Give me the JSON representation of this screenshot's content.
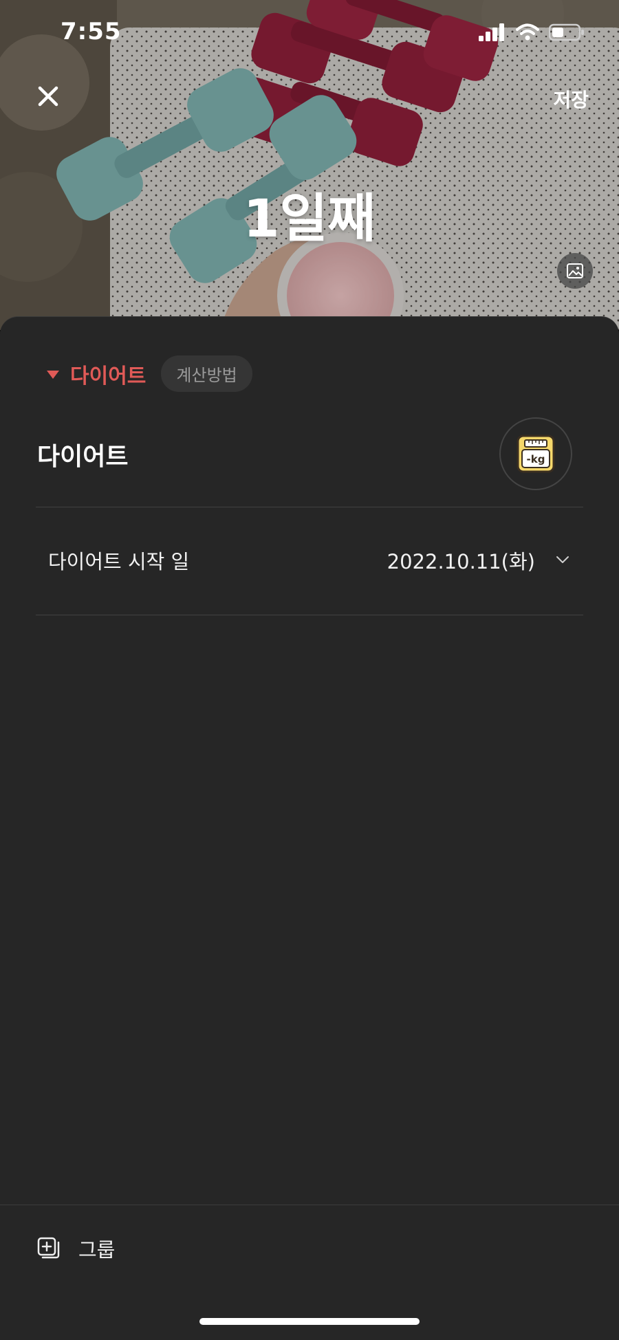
{
  "status_bar": {
    "time": "7:55",
    "signal_icon": "cellular-signal-icon",
    "wifi_icon": "wifi-icon",
    "battery_icon": "battery-icon"
  },
  "header": {
    "close_icon": "close-icon",
    "save_label": "저장",
    "title": "1일째",
    "change_image_icon": "image-edit-icon"
  },
  "category": {
    "label": "다이어트",
    "calc_method_label": "계산방법",
    "color": "#e05a57"
  },
  "goal": {
    "title": "다이어트",
    "icon": "scale-kg-icon",
    "icon_text": "-kg"
  },
  "start_date": {
    "label": "다이어트 시작 일",
    "value": "2022.10.11(화)"
  },
  "bottom": {
    "group_label": "그룹",
    "group_icon": "add-group-icon"
  }
}
